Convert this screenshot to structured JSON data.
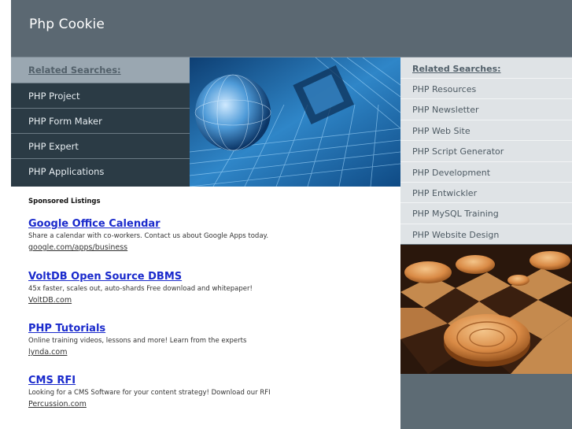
{
  "header": {
    "title": "Php Cookie"
  },
  "left_nav": {
    "heading": "Related Searches:",
    "items": [
      {
        "label": "PHP Project"
      },
      {
        "label": "PHP Form Maker"
      },
      {
        "label": "PHP Expert"
      },
      {
        "label": "PHP Applications"
      }
    ]
  },
  "sponsored": {
    "label": "Sponsored Listings",
    "listings": [
      {
        "title": "Google Office Calendar",
        "desc": "Share a calendar with co-workers. Contact us about Google Apps today.",
        "url": "google.com/apps/business"
      },
      {
        "title": "VoltDB Open Source DBMS",
        "desc": "45x faster, scales out, auto-shards Free download and whitepaper!",
        "url": "VoltDB.com"
      },
      {
        "title": "PHP Tutorials",
        "desc": "Online training videos, lessons and more! Learn from the experts",
        "url": "lynda.com"
      },
      {
        "title": "CMS RFI",
        "desc": "Looking for a CMS Software for your content strategy! Download our RFI",
        "url": "Percussion.com"
      }
    ]
  },
  "right_nav": {
    "heading": "Related Searches:",
    "items": [
      {
        "label": "PHP Resources"
      },
      {
        "label": "PHP Newsletter"
      },
      {
        "label": "PHP Web Site"
      },
      {
        "label": "PHP Script Generator"
      },
      {
        "label": "PHP Development"
      },
      {
        "label": "PHP Entwickler"
      },
      {
        "label": "PHP MySQL Training"
      },
      {
        "label": "PHP Website Design"
      }
    ]
  },
  "colors": {
    "header_bg": "#5b6872",
    "nav_bg": "#2a3a44",
    "link": "#1a2acc"
  }
}
